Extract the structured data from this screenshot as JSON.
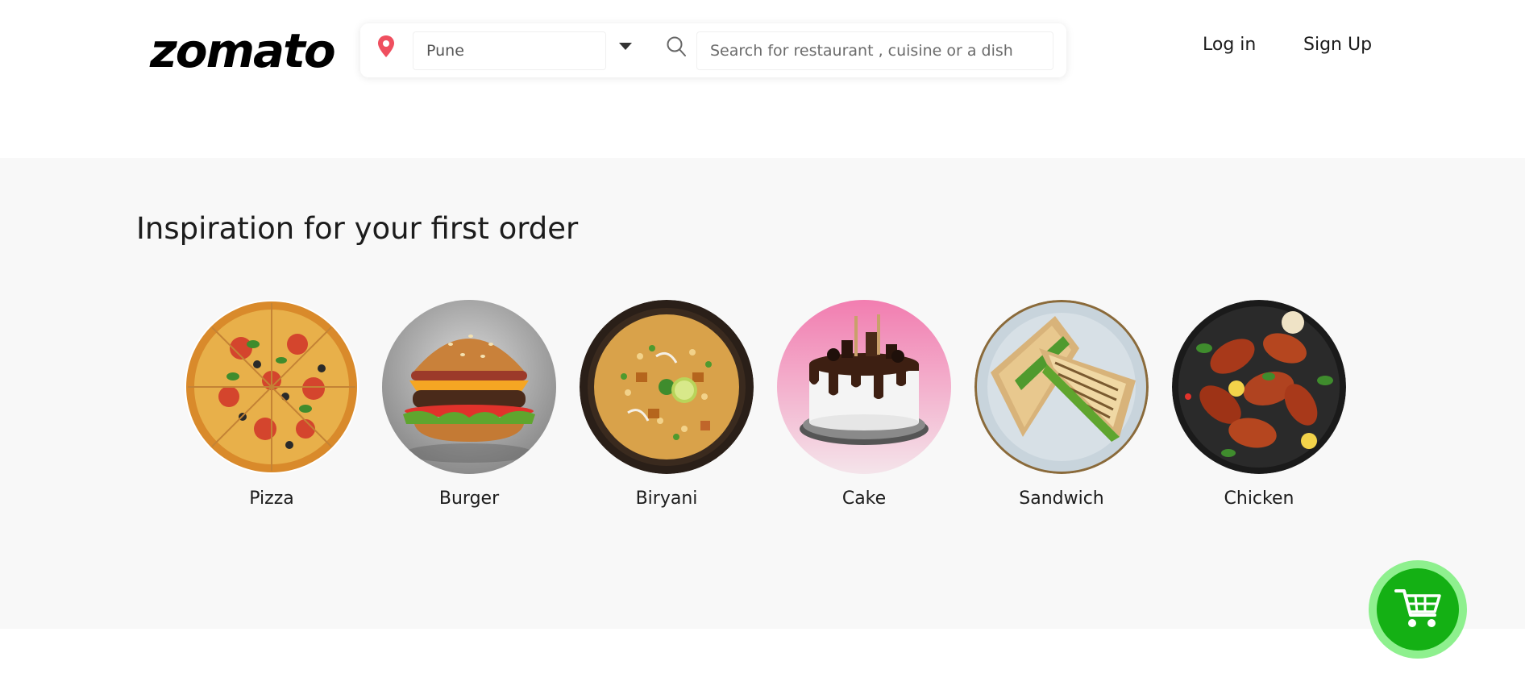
{
  "header": {
    "logo_text": "zomato",
    "location": {
      "value": "Pune",
      "icon": "location-pin-icon",
      "dropdown_icon": "caret-down-icon"
    },
    "search": {
      "icon": "search-icon",
      "placeholder": "Search for restaurant , cuisine or a dish",
      "value": ""
    },
    "nav": {
      "login_label": "Log in",
      "signup_label": "Sign Up"
    }
  },
  "inspiration": {
    "title": "Inspiration for your first order",
    "items": [
      {
        "label": "Pizza"
      },
      {
        "label": "Burger"
      },
      {
        "label": "Biryani"
      },
      {
        "label": "Cake"
      },
      {
        "label": "Sandwich"
      },
      {
        "label": "Chicken"
      }
    ]
  },
  "cart": {
    "icon": "shopping-cart-icon"
  },
  "colors": {
    "brand_logo": "#000000",
    "location_pin": "#ef4f5f",
    "section_background": "#f8f8f8",
    "cart_outer": "#8ef08e",
    "cart_inner": "#14b014"
  }
}
